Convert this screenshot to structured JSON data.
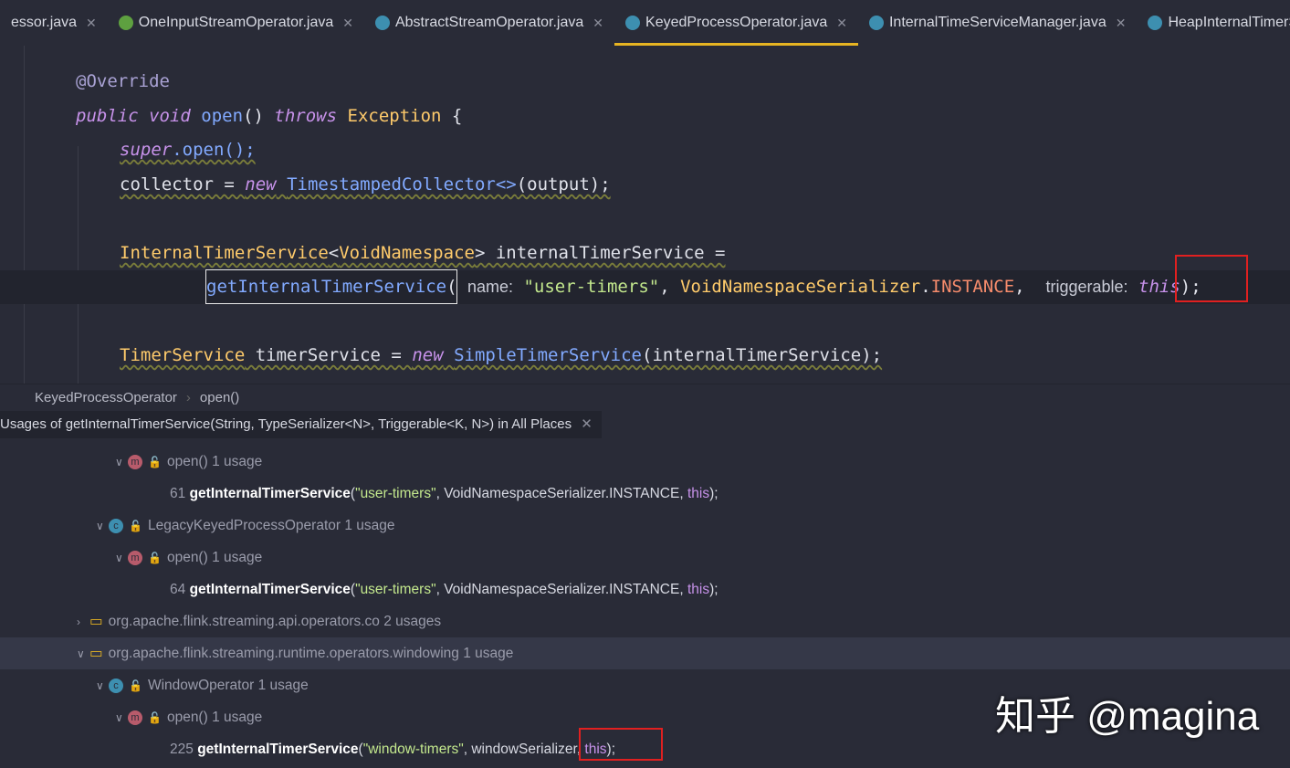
{
  "tabs": [
    {
      "label": "essor.java",
      "icon": "class-icon",
      "color": "#3d8fb0"
    },
    {
      "label": "OneInputStreamOperator.java",
      "icon": "interface-icon",
      "color": "#5ea040"
    },
    {
      "label": "AbstractStreamOperator.java",
      "icon": "abstract-class-icon",
      "color": "#3d8fb0"
    },
    {
      "label": "KeyedProcessOperator.java",
      "icon": "class-icon",
      "color": "#3d8fb0",
      "active": true
    },
    {
      "label": "InternalTimeServiceManager.java",
      "icon": "class-icon",
      "color": "#3d8fb0"
    },
    {
      "label": "HeapInternalTimerServ",
      "icon": "class-icon",
      "color": "#3d8fb0"
    }
  ],
  "code": {
    "l1": "@Override",
    "l2a": "public void",
    "l2b": "open",
    "l2c": "()",
    "l2d": "throws",
    "l2e": "Exception",
    "l2f": "{",
    "l3a": "super",
    "l3b": ".open();",
    "l4a": "collector = ",
    "l4b": "new",
    "l4c": "TimestampedCollector<>",
    "l4d": "(output);",
    "l5a": "InternalTimerService",
    "l5b": "<",
    "l5c": "VoidNamespace",
    "l5d": "> internalTimerService =",
    "l6a": "getInternalTimerService",
    "l6b": "( ",
    "l6c": "name:",
    "l6d": "\"user-timers\"",
    "l6e": ", ",
    "l6f": "VoidNamespaceSerializer",
    "l6g": ".",
    "l6h": "INSTANCE",
    "l6i": ",  ",
    "l6j": "triggerable:",
    "l6k": "this",
    "l6l": ");",
    "l7a": "TimerService",
    "l7b": " timerService = ",
    "l7c": "new",
    "l7d": "SimpleTimerService",
    "l7e": "(internalTimerService);"
  },
  "breadcrumb": [
    "KeyedProcessOperator",
    "open()"
  ],
  "usages_title": "Usages of getInternalTimerService(String, TypeSerializer<N>, Triggerable<K, N>) in All Places",
  "usages": {
    "r1": {
      "name": "open()",
      "count": "1 usage"
    },
    "r2": {
      "line": "61",
      "fn": "getInternalTimerService",
      "a": "(",
      "s": "\"user-timers\"",
      "b": ", VoidNamespaceSerializer.INSTANCE, ",
      "t": "this",
      "c": ");"
    },
    "r3": {
      "name": "LegacyKeyedProcessOperator",
      "count": "1 usage"
    },
    "r4": {
      "name": "open()",
      "count": "1 usage"
    },
    "r5": {
      "line": "64",
      "fn": "getInternalTimerService",
      "a": "(",
      "s": "\"user-timers\"",
      "b": ", VoidNamespaceSerializer.INSTANCE, ",
      "t": "this",
      "c": ");"
    },
    "r6": {
      "name": "org.apache.flink.streaming.api.operators.co",
      "count": "2 usages"
    },
    "r7": {
      "name": "org.apache.flink.streaming.runtime.operators.windowing",
      "count": "1 usage"
    },
    "r8": {
      "name": "WindowOperator",
      "count": "1 usage"
    },
    "r9": {
      "name": "open()",
      "count": "1 usage"
    },
    "r10": {
      "line": "225",
      "fn": "getInternalTimerService",
      "a": "(",
      "s": "\"window-timers\"",
      "b": ", windowSerializer, ",
      "t": "this",
      "c": ");"
    }
  },
  "watermark": "知乎 @magina"
}
